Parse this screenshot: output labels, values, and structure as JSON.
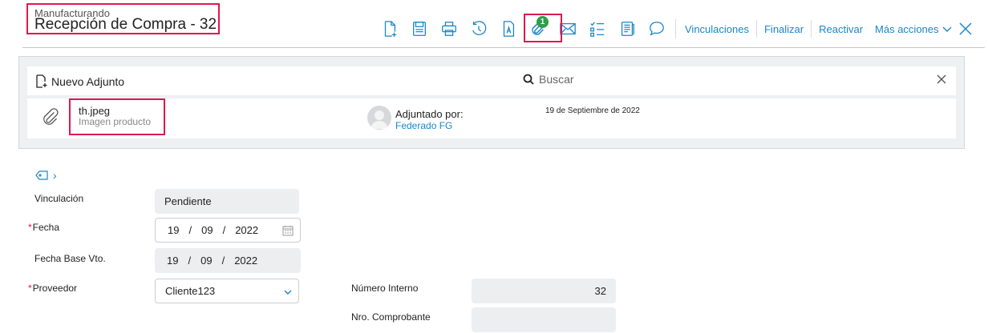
{
  "header": {
    "module": "Manufacturando",
    "title": "Recepción de Compra - 32"
  },
  "toolbar": {
    "icons": [
      "new-document-icon",
      "save-icon",
      "print-icon",
      "history-icon",
      "text-format-icon",
      "paperclip-icon",
      "mail-icon",
      "checklist-icon",
      "notes-icon",
      "comment-icon"
    ],
    "attach_count": "1",
    "links": {
      "vinculaciones": "Vinculaciones",
      "finalizar": "Finalizar",
      "reactivar": "Reactivar",
      "mas_acciones": "Más acciones"
    }
  },
  "attachments": {
    "new_label": "Nuevo Adjunto",
    "search_placeholder": "Buscar",
    "items": [
      {
        "file_name": "th.jpeg",
        "description": "Imagen producto",
        "attached_by_label": "Adjuntado por:",
        "attached_by": "Federado FG",
        "date": "19 de Septiembre de 2022"
      }
    ]
  },
  "form": {
    "vinculacion": {
      "label": "Vinculación",
      "value": "Pendiente"
    },
    "fecha": {
      "label": "Fecha",
      "required": "*",
      "day": "19",
      "month": "09",
      "year": "2022"
    },
    "fecha_base_vto": {
      "label": "Fecha Base Vto.",
      "day": "19",
      "month": "09",
      "year": "2022"
    },
    "proveedor": {
      "label": "Proveedor",
      "required": "*",
      "value": "Cliente123"
    },
    "numero_interno": {
      "label": "Número Interno",
      "value": "32"
    },
    "nro_comprobante": {
      "label": "Nro. Comprobante",
      "value": ""
    },
    "date_separator": "/"
  },
  "colors": {
    "accent": "#1a86c8",
    "highlight": "#e0174f",
    "badge": "#2e9e48"
  }
}
